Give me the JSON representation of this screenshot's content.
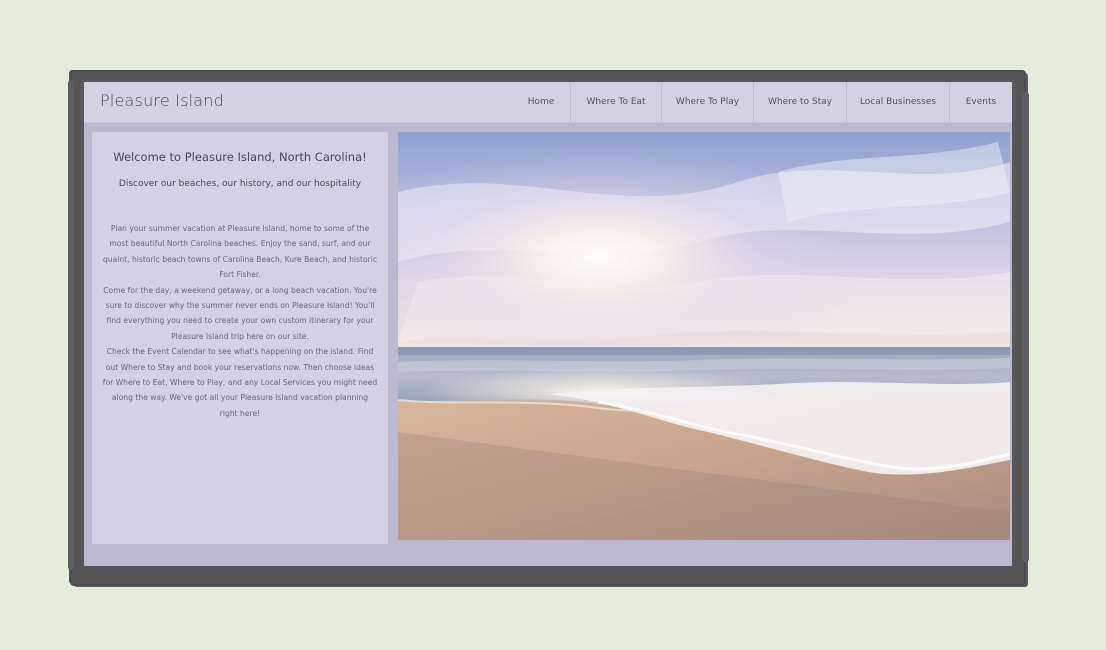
{
  "site": {
    "title": "Pleasure Island"
  },
  "nav": {
    "items": [
      {
        "label": "Home"
      },
      {
        "label": "Where To Eat"
      },
      {
        "label": "Where To Play"
      },
      {
        "label": "Where to Stay"
      },
      {
        "label": "Local Businesses"
      },
      {
        "label": "Events"
      }
    ]
  },
  "intro": {
    "heading": "Welcome to Pleasure Island, North Carolina!",
    "tagline": "Discover our beaches, our history, and our hospitality",
    "paragraphs": [
      "Plan your summer vacation at Pleasure Island, home to some of the most beautiful North Carolina beaches. Enjoy the sand, surf, and our quaint, historic beach towns of Carolina Beach, Kure Beach, and historic Fort Fisher.",
      "Come for the day, a weekend getaway, or a long beach vacation. You're sure to discover why the summer never ends on Pleasure Island! You'll find everything you need to create your own custom itinerary for your Pleasure Island trip here on our site.",
      "Check the Event Calendar to see what's happening on the island. Find out Where to Stay and book your reservations now. Then choose ideas for Where to Eat, Where to Play, and any Local Services you might need along the way. We've got all your Pleasure Island vacation planning right here!"
    ]
  },
  "colors": {
    "page_background": "#e4ecdb",
    "frame": "#575759",
    "navbar": "#d4d2e1",
    "panel": "#d3d1e2",
    "site_background": "#bbb8cf"
  },
  "hero_image": {
    "icon": "beach-sunset-photo"
  }
}
